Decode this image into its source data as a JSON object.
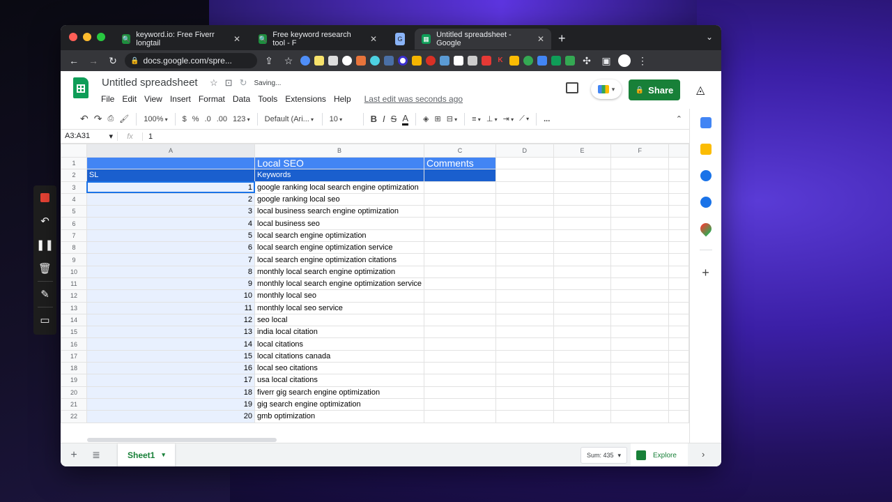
{
  "recording_toolbar": {
    "colors": {
      "stop": "#ea4335"
    }
  },
  "browser": {
    "tabs": [
      {
        "title": "keyword.io: Free Fiverr longtail",
        "favicon_color": "#1e8e3e"
      },
      {
        "title": "Free keyword research tool - F",
        "favicon_color": "#1e8e3e"
      },
      {
        "title": "G",
        "favicon_color": "#8ab4f8"
      },
      {
        "title": "Untitled spreadsheet - Google",
        "favicon_color": "#0f9d58"
      }
    ],
    "url": "docs.google.com/spre..."
  },
  "doc": {
    "title": "Untitled spreadsheet",
    "saving": "Saving...",
    "menus": [
      "File",
      "Edit",
      "View",
      "Insert",
      "Format",
      "Data",
      "Tools",
      "Extensions",
      "Help"
    ],
    "last_edit": "Last edit was seconds ago",
    "share_label": "Share"
  },
  "format_toolbar": {
    "zoom": "100%",
    "currency": "$",
    "percent": "%",
    "dec_less": ".0",
    "dec_more": ".00",
    "number_format": "123",
    "font": "Default (Ari...",
    "font_size": "10",
    "bold": "B",
    "italic": "I",
    "strike": "S",
    "text_color": "A",
    "more": "..."
  },
  "formula_bar": {
    "name_box": "A3:A31",
    "fx": "fx",
    "value": "1"
  },
  "grid": {
    "columns": [
      "A",
      "B",
      "C",
      "D",
      "E",
      "F"
    ],
    "header_row": {
      "title": "Local SEO",
      "comments": "Comments"
    },
    "subheader_row": {
      "sl": "SL",
      "keywords": "Keywords"
    },
    "rows": [
      {
        "n": "3",
        "sl": "1",
        "kw": "google ranking local search engine optimization"
      },
      {
        "n": "4",
        "sl": "2",
        "kw": "google ranking local seo"
      },
      {
        "n": "5",
        "sl": "3",
        "kw": "local business search engine optimization"
      },
      {
        "n": "6",
        "sl": "4",
        "kw": "local business seo"
      },
      {
        "n": "7",
        "sl": "5",
        "kw": "local search engine optimization"
      },
      {
        "n": "8",
        "sl": "6",
        "kw": "local search engine optimization service"
      },
      {
        "n": "9",
        "sl": "7",
        "kw": "local search engine optimization citations"
      },
      {
        "n": "10",
        "sl": "8",
        "kw": "monthly local search engine optimization"
      },
      {
        "n": "11",
        "sl": "9",
        "kw": "monthly local search engine optimization service"
      },
      {
        "n": "12",
        "sl": "10",
        "kw": "monthly local seo"
      },
      {
        "n": "13",
        "sl": "11",
        "kw": "monthly local seo service"
      },
      {
        "n": "14",
        "sl": "12",
        "kw": "seo local"
      },
      {
        "n": "15",
        "sl": "13",
        "kw": "india local citation"
      },
      {
        "n": "16",
        "sl": "14",
        "kw": "local citations"
      },
      {
        "n": "17",
        "sl": "15",
        "kw": "local citations canada"
      },
      {
        "n": "18",
        "sl": "16",
        "kw": "local seo citations"
      },
      {
        "n": "19",
        "sl": "17",
        "kw": "usa local citations"
      },
      {
        "n": "20",
        "sl": "18",
        "kw": "fiverr gig search engine optimization"
      },
      {
        "n": "21",
        "sl": "19",
        "kw": "gig search engine optimization"
      },
      {
        "n": "22",
        "sl": "20",
        "kw": "gmb optimization"
      }
    ]
  },
  "sheetbar": {
    "sheet_name": "Sheet1",
    "sum": "Sum: 435",
    "explore": "Explore"
  },
  "colors": {
    "header_blue": "#4285f4",
    "subheader_blue": "#1a5fce",
    "share_green": "#188038"
  }
}
